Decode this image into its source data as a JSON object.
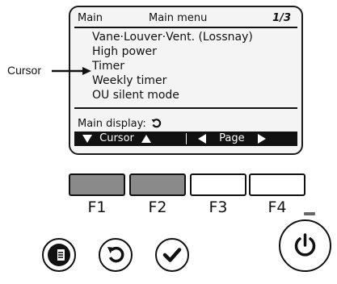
{
  "screen": {
    "header": {
      "left": "Main",
      "title": "Main menu",
      "page": "1/3"
    },
    "menu_items": [
      "Vane·Louver·Vent. (Lossnay)",
      "High power",
      "Timer",
      "Weekly timer",
      "OU silent mode"
    ],
    "selected_index": 2,
    "main_display_label": "Main display:",
    "softkeys": {
      "cursor_label": "Cursor",
      "page_label": "Page"
    }
  },
  "callout": {
    "label": "Cursor"
  },
  "function_keys": [
    {
      "label": "F1",
      "state": "pressed"
    },
    {
      "label": "F2",
      "state": "pressed"
    },
    {
      "label": "F3",
      "state": "released"
    },
    {
      "label": "F4",
      "state": "released"
    }
  ],
  "buttons": {
    "menu": "menu-icon",
    "return": "return-icon",
    "select": "check-icon",
    "power": "power-icon"
  },
  "colors": {
    "lcd_background": "#f4f4f4",
    "pressed_key": "#8a8a8a",
    "ink": "#111111"
  }
}
